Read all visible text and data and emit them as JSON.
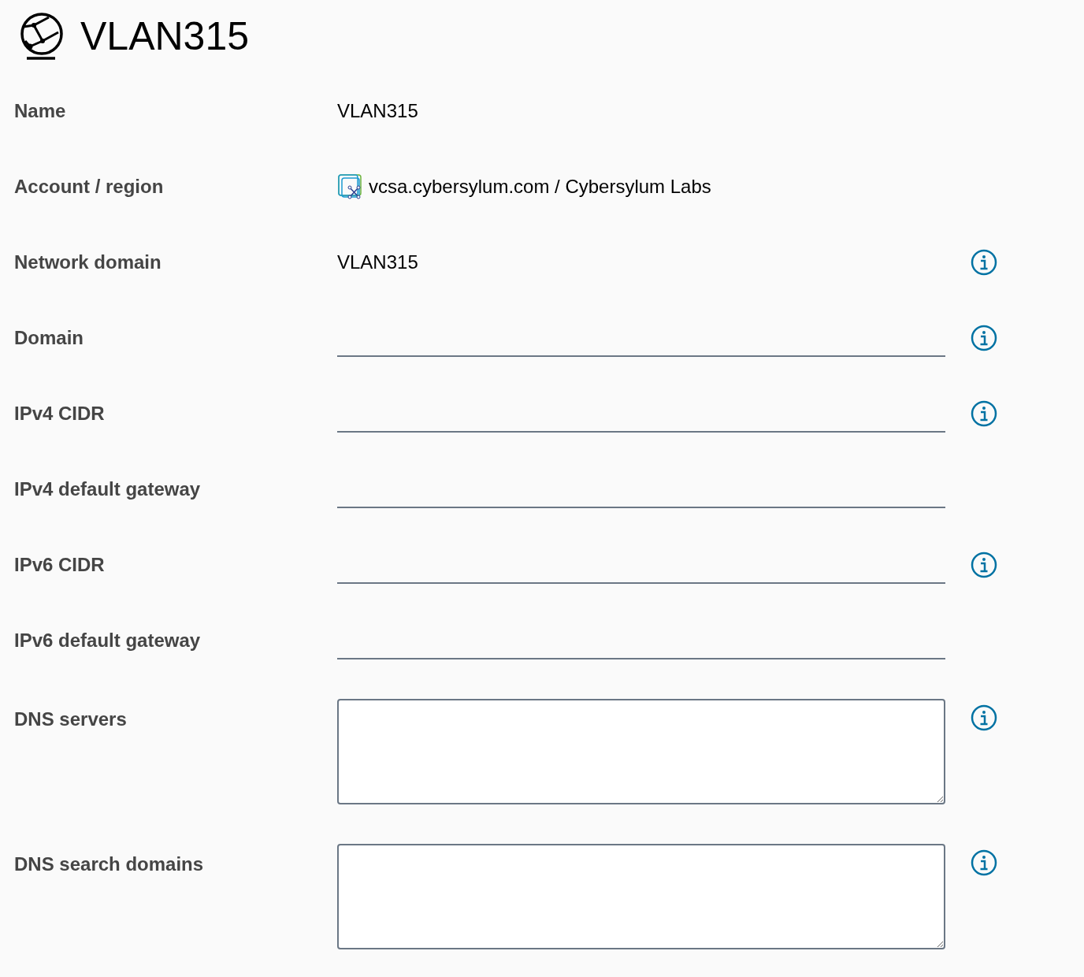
{
  "header": {
    "title": "VLAN315"
  },
  "fields": [
    {
      "label": "Name",
      "kind": "text",
      "value": "VLAN315",
      "info": false
    },
    {
      "label": "Account / region",
      "kind": "account",
      "value": "vcsa.cybersylum.com / Cybersylum Labs",
      "info": false
    },
    {
      "label": "Network domain",
      "kind": "text",
      "value": "VLAN315",
      "info": true
    },
    {
      "label": "Domain",
      "kind": "input",
      "info": true
    },
    {
      "label": "IPv4 CIDR",
      "kind": "input",
      "info": true
    },
    {
      "label": "IPv4 default gateway",
      "kind": "input",
      "info": false
    },
    {
      "label": "IPv6 CIDR",
      "kind": "input",
      "info": true
    },
    {
      "label": "IPv6 default gateway",
      "kind": "input",
      "info": false
    },
    {
      "label": "DNS servers",
      "kind": "textarea",
      "info": true
    },
    {
      "label": "DNS search domains",
      "kind": "textarea",
      "info": true
    }
  ]
}
